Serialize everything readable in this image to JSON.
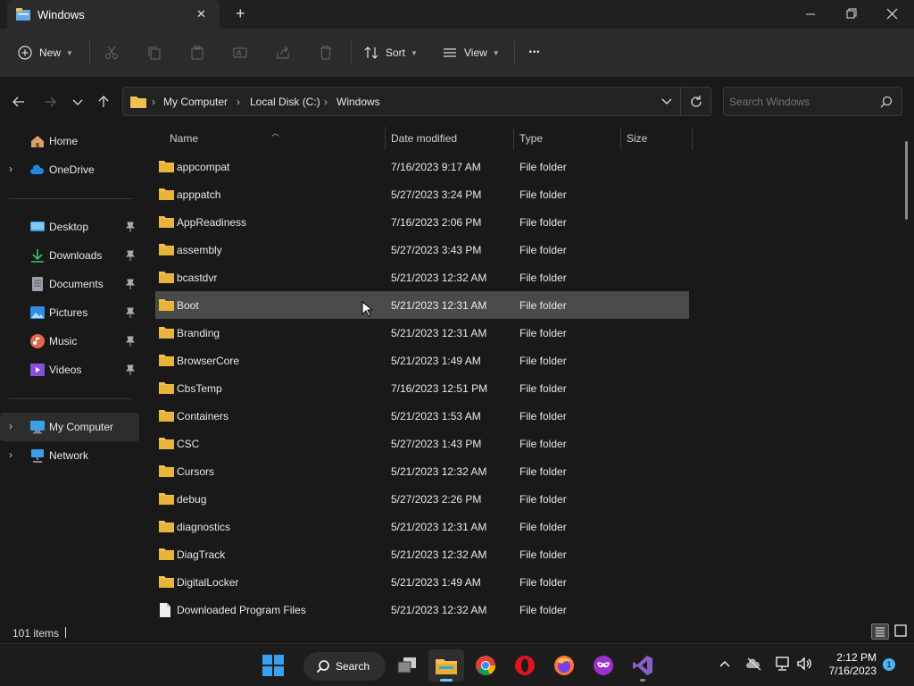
{
  "window": {
    "tab_title": "Windows",
    "tab_close": "✕",
    "new_tab": "+"
  },
  "toolbar": {
    "new_label": "New",
    "sort_label": "Sort",
    "view_label": "View",
    "more_label": "···"
  },
  "address": {
    "breadcrumb": [
      "My Computer",
      "Local Disk (C:)",
      "Windows"
    ],
    "search_placeholder": "Search Windows"
  },
  "sidebar": {
    "items": [
      {
        "label": "Home",
        "icon": "home-icon"
      },
      {
        "label": "OneDrive",
        "icon": "cloud-icon"
      },
      {
        "label": "Desktop",
        "icon": "desktop-icon"
      },
      {
        "label": "Downloads",
        "icon": "download-icon"
      },
      {
        "label": "Documents",
        "icon": "document-icon"
      },
      {
        "label": "Pictures",
        "icon": "picture-icon"
      },
      {
        "label": "Music",
        "icon": "music-icon"
      },
      {
        "label": "Videos",
        "icon": "video-icon"
      },
      {
        "label": "My Computer",
        "icon": "computer-icon"
      },
      {
        "label": "Network",
        "icon": "network-icon"
      }
    ]
  },
  "columns": {
    "name": "Name",
    "date": "Date modified",
    "type": "Type",
    "size": "Size"
  },
  "files": [
    {
      "name": "appcompat",
      "date": "7/16/2023 9:17 AM",
      "type": "File folder"
    },
    {
      "name": "apppatch",
      "date": "5/27/2023 3:24 PM",
      "type": "File folder"
    },
    {
      "name": "AppReadiness",
      "date": "7/16/2023 2:06 PM",
      "type": "File folder"
    },
    {
      "name": "assembly",
      "date": "5/27/2023 3:43 PM",
      "type": "File folder"
    },
    {
      "name": "bcastdvr",
      "date": "5/21/2023 12:32 AM",
      "type": "File folder"
    },
    {
      "name": "Boot",
      "date": "5/21/2023 12:31 AM",
      "type": "File folder"
    },
    {
      "name": "Branding",
      "date": "5/21/2023 12:31 AM",
      "type": "File folder"
    },
    {
      "name": "BrowserCore",
      "date": "5/21/2023 1:49 AM",
      "type": "File folder"
    },
    {
      "name": "CbsTemp",
      "date": "7/16/2023 12:51 PM",
      "type": "File folder"
    },
    {
      "name": "Containers",
      "date": "5/21/2023 1:53 AM",
      "type": "File folder"
    },
    {
      "name": "CSC",
      "date": "5/27/2023 1:43 PM",
      "type": "File folder"
    },
    {
      "name": "Cursors",
      "date": "5/21/2023 12:32 AM",
      "type": "File folder"
    },
    {
      "name": "debug",
      "date": "5/27/2023 2:26 PM",
      "type": "File folder"
    },
    {
      "name": "diagnostics",
      "date": "5/21/2023 12:31 AM",
      "type": "File folder"
    },
    {
      "name": "DiagTrack",
      "date": "5/21/2023 12:32 AM",
      "type": "File folder"
    },
    {
      "name": "DigitalLocker",
      "date": "5/21/2023 1:49 AM",
      "type": "File folder"
    },
    {
      "name": "Downloaded Program Files",
      "date": "5/21/2023 12:32 AM",
      "type": "File folder"
    }
  ],
  "status": {
    "item_count": "101 items"
  },
  "taskbar": {
    "search_label": "Search",
    "time": "2:12 PM",
    "date": "7/16/2023",
    "notification_count": "1"
  },
  "colors": {
    "accent": "#0078d4",
    "folder": "#f0c050",
    "selected_row": "#4a4a4a"
  }
}
